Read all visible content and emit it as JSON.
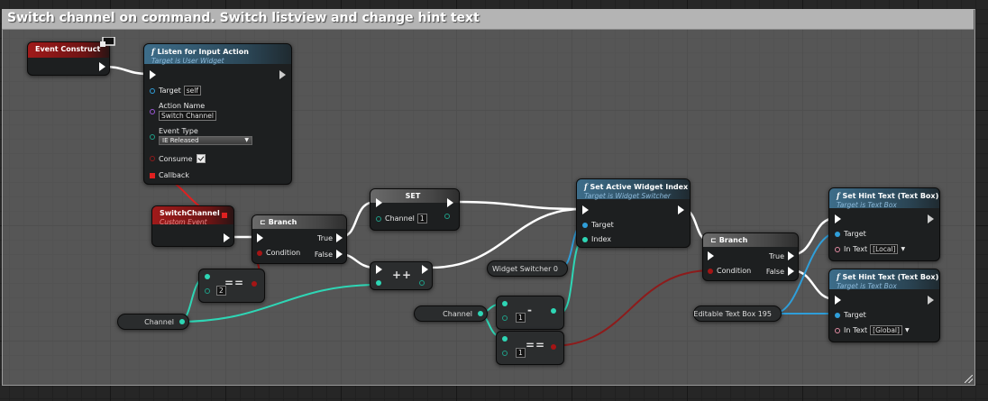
{
  "comment": {
    "title": "Switch channel on command. Switch listview and change hint text"
  },
  "event_construct": {
    "title": "Event Construct"
  },
  "listen_for_input": {
    "title": "Listen for Input Action",
    "subtitle": "Target is User Widget",
    "target_label": "Target",
    "target_value": "self",
    "action_name_label": "Action Name",
    "action_name_value": "Switch Channel",
    "event_type_label": "Event Type",
    "event_type_value": "IE Released",
    "consume_label": "Consume",
    "consume_checked": true,
    "callback_label": "Callback"
  },
  "switch_channel_event": {
    "title": "SwitchChannel",
    "subtitle": "Custom Event"
  },
  "branch1": {
    "title": "Branch",
    "condition_label": "Condition",
    "true_label": "True",
    "false_label": "False"
  },
  "set_node": {
    "title": "SET",
    "channel_label": "Channel",
    "channel_value": "1"
  },
  "increment": {
    "symbol": "++"
  },
  "equals1": {
    "symbol": "==",
    "value": "2"
  },
  "channel_var1": {
    "label": "Channel"
  },
  "set_active_widget": {
    "title": "Set Active Widget Index",
    "subtitle": "Target is Widget Switcher",
    "target_label": "Target",
    "index_label": "Index"
  },
  "widget_switcher_var": {
    "label": "Widget Switcher 0"
  },
  "channel_var2": {
    "label": "Channel"
  },
  "subtract": {
    "symbol": "-",
    "value": "1"
  },
  "equals2": {
    "symbol": "==",
    "value": "1"
  },
  "branch2": {
    "title": "Branch",
    "condition_label": "Condition",
    "true_label": "True",
    "false_label": "False"
  },
  "editable_text_var": {
    "label": "Editable Text Box 195"
  },
  "set_hint_local": {
    "title": "Set Hint Text (Text Box)",
    "subtitle": "Target is Text Box",
    "target_label": "Target",
    "in_text_label": "In Text",
    "in_text_value": "[Local]"
  },
  "set_hint_global": {
    "title": "Set Hint Text (Text Box)",
    "subtitle": "Target is Text Box",
    "target_label": "Target",
    "in_text_label": "In Text",
    "in_text_value": "[Global]"
  },
  "colors": {
    "exec_wire": "#ffffff",
    "int_wire": "#2ed6b5",
    "bool_wire": "#8d1b1b",
    "object_wire": "#2f9ed9",
    "delegate_wire": "#e02020"
  }
}
